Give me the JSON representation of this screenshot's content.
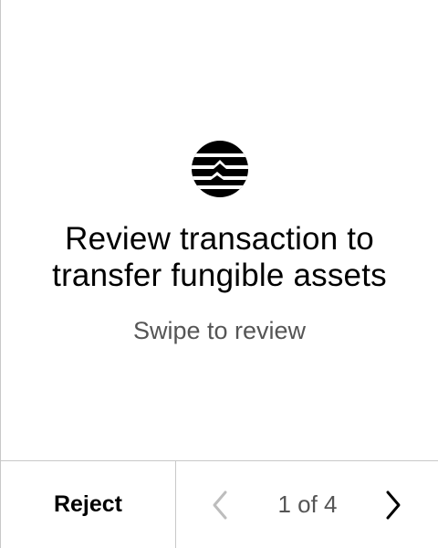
{
  "review": {
    "logo_icon": "aptos-logo-icon",
    "title_line1": "Review transaction to",
    "title_line2": "transfer fungible assets",
    "subtitle": "Swipe to review"
  },
  "footer": {
    "reject_label": "Reject",
    "page_indicator": "1 of 4",
    "prev_icon": "chevron-left-icon",
    "next_icon": "chevron-right-icon"
  },
  "colors": {
    "text": "#000000",
    "muted": "#555555",
    "disabled": "#bdbdbd",
    "divider": "#c8c8c8",
    "background": "#ffffff"
  }
}
